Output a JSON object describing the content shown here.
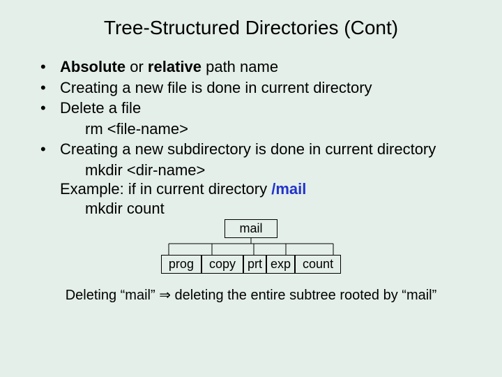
{
  "title": "Tree-Structured Directories (Cont)",
  "bullets": {
    "b1": {
      "mark": "•",
      "bold1": "Absolute",
      "mid": " or ",
      "bold2": "relative",
      "rest": " path name"
    },
    "b2": {
      "mark": "•",
      "text": "Creating a new file is done in current directory"
    },
    "b3": {
      "mark": "•",
      "text": "Delete a file"
    },
    "b3a": "rm <file-name>",
    "b4": {
      "mark": "•",
      "text": "Creating a new subdirectory is done in current directory"
    },
    "b4a": "mkdir <dir-name>",
    "b4ex_pre": "Example:  if in current directory   ",
    "b4ex_blue": "/mail",
    "b4b": "mkdir count"
  },
  "tree": {
    "root": "mail",
    "children": [
      "prog",
      "copy",
      "prt",
      "exp",
      "count"
    ]
  },
  "footer": {
    "pre": "Deleting “mail” ",
    "arrow": "⇒",
    "post": " deleting the entire subtree rooted by “mail”"
  }
}
